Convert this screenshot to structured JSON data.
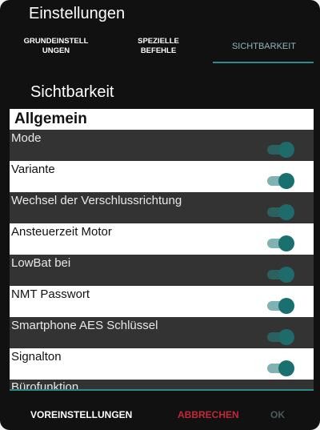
{
  "dialog": {
    "title": "Einstellungen",
    "tabs": [
      {
        "label": "GRUNDEINSTELL\nUNGEN",
        "selected": false
      },
      {
        "label": "SPEZIELLE\nBEFEHLE",
        "selected": false
      },
      {
        "label": "SICHTBARKEIT",
        "selected": true
      }
    ],
    "section_title": "Sichtbarkeit",
    "group_header": "Allgemein",
    "items": [
      {
        "label": "Mode",
        "enabled": true
      },
      {
        "label": "Variante",
        "enabled": true
      },
      {
        "label": "Wechsel der Verschlussrichtung",
        "enabled": true
      },
      {
        "label": "Ansteuerzeit Motor",
        "enabled": true
      },
      {
        "label": "LowBat bei",
        "enabled": true
      },
      {
        "label": "NMT Passwort",
        "enabled": true
      },
      {
        "label": "Smartphone AES Schlüssel",
        "enabled": true
      },
      {
        "label": "Signalton",
        "enabled": true
      },
      {
        "label": "Bürofunktion",
        "enabled": true
      }
    ],
    "actions": {
      "defaults": "VOREINSTELLUNGEN",
      "cancel": "ABBRECHEN",
      "ok": "OK"
    }
  },
  "colors": {
    "accent": "#2f8b8b",
    "cancel": "#c0283c",
    "ok_disabled": "#4a5c5c",
    "background": "#111111",
    "row_dark": "#333333",
    "row_light": "#ffffff"
  }
}
